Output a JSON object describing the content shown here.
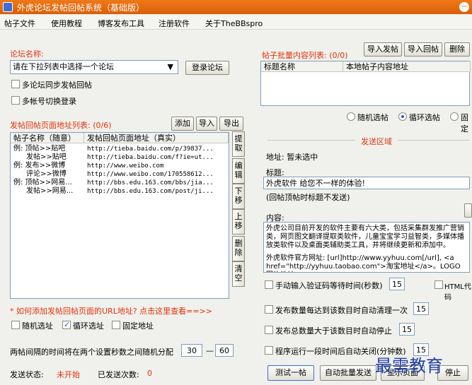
{
  "window": {
    "title": "外虎论坛发帖回帖系统（基础版）"
  },
  "menu": [
    "帖子文件",
    "使用教程",
    "博客发布工具",
    "注册软件",
    "关于TheBBspro"
  ],
  "forum": {
    "label": "论坛名称:",
    "select_value": "请在下拉列表中选择一个论坛",
    "login_button": "登录论坛",
    "multi_forum": "多论坛同步发帖回帖",
    "multi_account": "多帐号切换登录"
  },
  "url_list": {
    "label": "发帖回帖页面地址列表: (0/6)",
    "buttons": [
      "添加",
      "导入",
      "导出"
    ],
    "headers": [
      "帖子名称（随意）",
      "发帖回帖页面地址（真实）"
    ],
    "rows": [
      [
        "例: 顶帖>>贴吧",
        "http://tieba.baidu.com/p/39837..."
      ],
      [
        "发帖>>贴吧",
        "http://tieba.baidu.com/f?ie=ut..."
      ],
      [
        "例: 发布>>微博",
        "http://www.weibo.com"
      ],
      [
        "评论>>微博",
        "http://www.weibo.com/170558612..."
      ],
      [
        "例: 顶帖>>网易...",
        "http://bbs.edu.163.com/bbs/jia..."
      ],
      [
        "发帖>>网易...",
        "http://bbs.edu.163.com/post/ji..."
      ]
    ],
    "side_buttons": [
      "提取",
      "编辑",
      "下移",
      "上移",
      "删除",
      "清空"
    ]
  },
  "help_link": "* 如何添加发帖回帖页面的URL地址? 点击这里查看==>>",
  "select_mode": {
    "random": "随机选址",
    "cycle": "循环选址",
    "fixed": "固定地址"
  },
  "interval": {
    "label": "两帖间隔的时间将在两个设置秒数之间随机分配",
    "min": "30",
    "sep": "—",
    "max": "60"
  },
  "status": {
    "label": "发送状态:",
    "value": "未开始",
    "sent_label": "已发送次数:",
    "sent_value": "0"
  },
  "batch": {
    "label": "帖子批量内容列表: (0/0)",
    "buttons": [
      "导入发帖",
      "导入回帖",
      "删除"
    ],
    "headers": [
      "标题名称",
      "本地帖子内容地址"
    ],
    "random_post": "随机选帖",
    "cycle_post": "循环选帖",
    "fixed_post": "固定"
  },
  "send": {
    "section": "发送区域",
    "address": "地址: 暂未选中",
    "title_label": "标题:",
    "title_value": "外虎软件 给您不一样的体验!",
    "title_note": "(回帖顶帖时标题不发送)",
    "content_label": "内容:",
    "content_value": "外虎公司目前开发的软件主要有六大类，包括采集群发推广营销类，网页图文翻译提取类软件，儿童宝宝学习益智类，多媒体播放类软件以及桌面类辅助类工具，并将继续更新和添加中。",
    "content_value2": "外虎软件官方网址: [url]http://www.yyhuu.com[/url], <a href=\"http://yyhuu.taobao.com\">淘宝地址</a>。LOGO图片地址",
    "captcha_label": "手动输入验证码等待时间(秒数)",
    "captcha_value": "15",
    "html_code": "HTML代码",
    "clear_label": "发布数量每达到该数目时自动清理一次",
    "clear_value": "15",
    "stop_label": "发布总数量大于该数目时自动停止",
    "stop_value": "15",
    "close_label": "程序运行一段时间后自动关闭(分钟数)",
    "close_value": "15"
  },
  "actions": {
    "test": "测试一帖",
    "batch": "自动批量发送",
    "show": "显示页面",
    "stop": "停止"
  },
  "watermark": "最需教育"
}
